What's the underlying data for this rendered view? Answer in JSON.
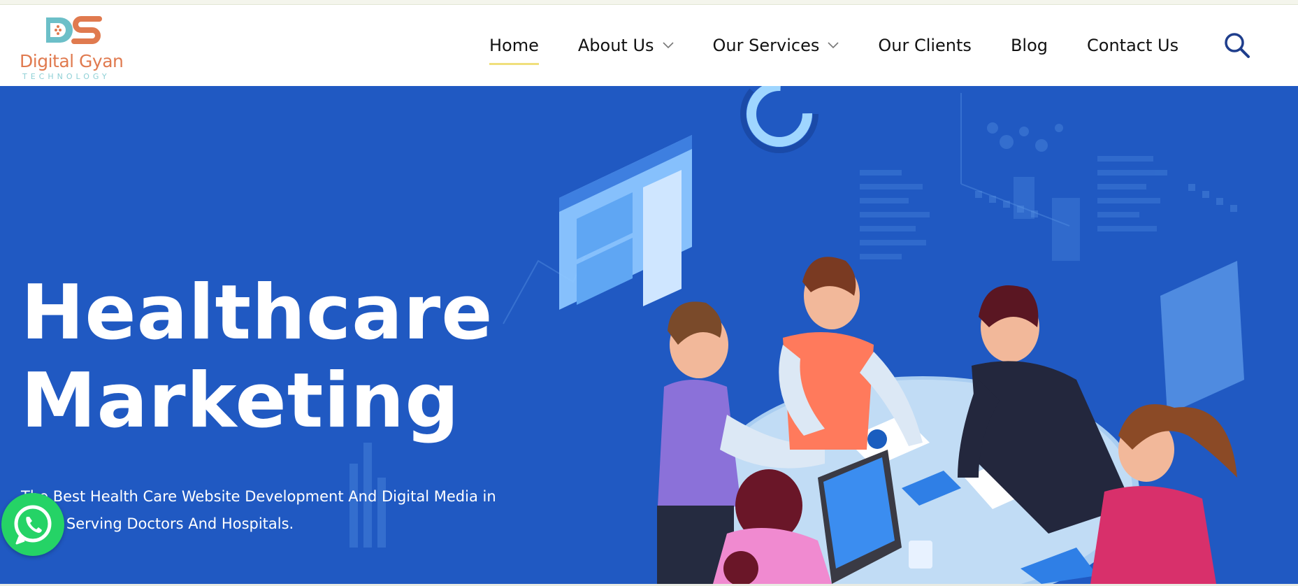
{
  "brand": {
    "name": "Digital Gyan",
    "tagline": "TECHNOLOGY",
    "colors": {
      "orange": "#e07a4f",
      "teal": "#6cbfc8"
    }
  },
  "nav": {
    "items": [
      {
        "label": "Home",
        "active": true,
        "dropdown": false
      },
      {
        "label": "About Us",
        "active": false,
        "dropdown": true
      },
      {
        "label": "Our Services",
        "active": false,
        "dropdown": true
      },
      {
        "label": "Our Clients",
        "active": false,
        "dropdown": false
      },
      {
        "label": "Blog",
        "active": false,
        "dropdown": false
      },
      {
        "label": "Contact Us",
        "active": false,
        "dropdown": false
      }
    ],
    "search_icon": "search-icon",
    "active_underline_color": "#f0df7c"
  },
  "hero": {
    "title_line1": "Healthcare",
    "title_line2": "Marketing",
    "subtitle": "The Best Health Care Website Development And Digital Media in India, Serving Doctors And Hospitals.",
    "background_color": "#2059c2"
  },
  "whatsapp": {
    "icon": "whatsapp-icon",
    "color": "#25d366"
  }
}
